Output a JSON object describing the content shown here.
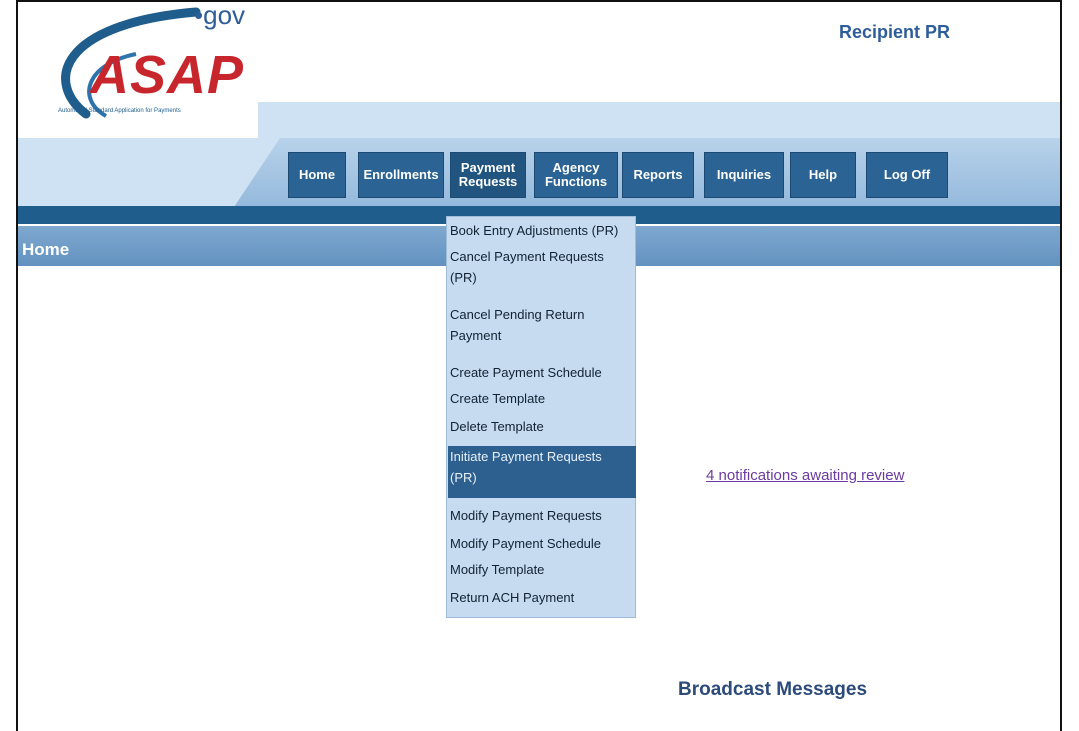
{
  "header": {
    "logo_text": "ASAP",
    "logo_suffix": "•gov",
    "logo_tagline": "Automated Standard Application for Payments",
    "role": "Recipient PR"
  },
  "nav": {
    "items": [
      {
        "label": "Home"
      },
      {
        "label": "Enrollments"
      },
      {
        "label": "Payment Requests"
      },
      {
        "label": "Agency Functions"
      },
      {
        "label": "Reports"
      },
      {
        "label": "Inquiries"
      },
      {
        "label": "Help"
      },
      {
        "label": "Log Off"
      }
    ]
  },
  "page": {
    "title": "Home"
  },
  "dropdown": {
    "items": [
      "Book Entry Adjustments (PR)",
      "Cancel Payment Requests (PR)",
      "Cancel Pending Return Payment",
      "Create Payment Schedule",
      "Create Template",
      "Delete Template",
      "Initiate Payment Requests (PR)",
      "Modify Payment Requests",
      "Modify Payment Schedule",
      "Modify Template",
      "Return ACH Payment"
    ],
    "selected": "Initiate Payment Requests (PR)"
  },
  "notifications": {
    "link_text": "4 notifications awaiting review"
  },
  "broadcast": {
    "title": "Broadcast Messages"
  },
  "colors": {
    "nav": "#2a6394",
    "accent": "#2e5d9a",
    "band": "#cfe2f3",
    "link": "#6b3aa0"
  }
}
